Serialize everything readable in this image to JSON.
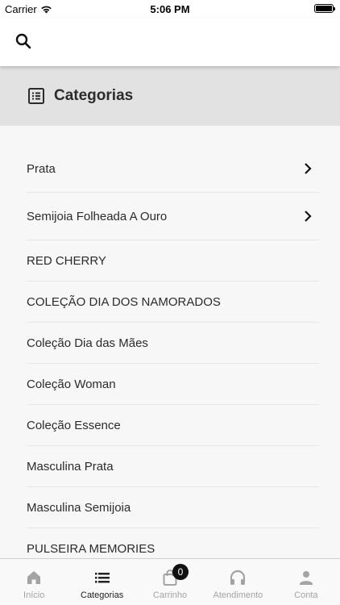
{
  "status_bar": {
    "carrier": "Carrier",
    "time": "5:06 PM"
  },
  "top_bar": {
    "search_icon": "search-icon"
  },
  "header": {
    "title": "Categorias",
    "icon": "list-icon"
  },
  "categories": [
    {
      "label": "Prata",
      "has_children": true
    },
    {
      "label": "Semijoia Folheada A Ouro",
      "has_children": true
    },
    {
      "label": "RED CHERRY",
      "has_children": false
    },
    {
      "label": "COLEÇÃO DIA DOS NAMORADOS",
      "has_children": false
    },
    {
      "label": "Coleção Dia das Mães",
      "has_children": false
    },
    {
      "label": "Coleção Woman",
      "has_children": false
    },
    {
      "label": "Coleção Essence",
      "has_children": false
    },
    {
      "label": "Masculina Prata",
      "has_children": false
    },
    {
      "label": "Masculina Semijoia",
      "has_children": false
    },
    {
      "label": "PULSEIRA MEMORIES",
      "has_children": false
    }
  ],
  "tab_bar": {
    "tabs": [
      {
        "label": "Início",
        "icon": "home-icon",
        "active": false
      },
      {
        "label": "Categorias",
        "icon": "list-icon",
        "active": true
      },
      {
        "label": "Carrinho",
        "icon": "shopping-bag-icon",
        "active": false,
        "badge": "0"
      },
      {
        "label": "Atendimento",
        "icon": "headphones-icon",
        "active": false
      },
      {
        "label": "Conta",
        "icon": "person-icon",
        "active": false
      }
    ]
  }
}
